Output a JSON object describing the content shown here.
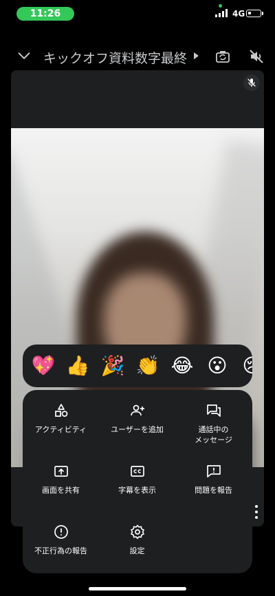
{
  "status_bar": {
    "time": "11:26",
    "network": "4G"
  },
  "header": {
    "title": "キックオフ資料数字最終…"
  },
  "reactions": [
    {
      "emoji": "💖",
      "name": "sparkling-heart"
    },
    {
      "emoji": "👍",
      "name": "thumbs-up"
    },
    {
      "emoji": "🎉",
      "name": "party-popper"
    },
    {
      "emoji": "👏",
      "name": "clapping-hands"
    },
    {
      "emoji": "😂",
      "name": "tears-of-joy"
    },
    {
      "emoji": "😮",
      "name": "surprised"
    },
    {
      "emoji": "😢",
      "name": "crying"
    }
  ],
  "menu": {
    "activities": "アクティビティ",
    "add_user": "ユーザーを追加",
    "in_call_messages": "通話中の\nメッセージ",
    "share_screen": "画面を共有",
    "show_captions": "字幕を表示",
    "report_problem": "問題を報告",
    "report_abuse": "不正行為の報告",
    "settings": "設定"
  }
}
